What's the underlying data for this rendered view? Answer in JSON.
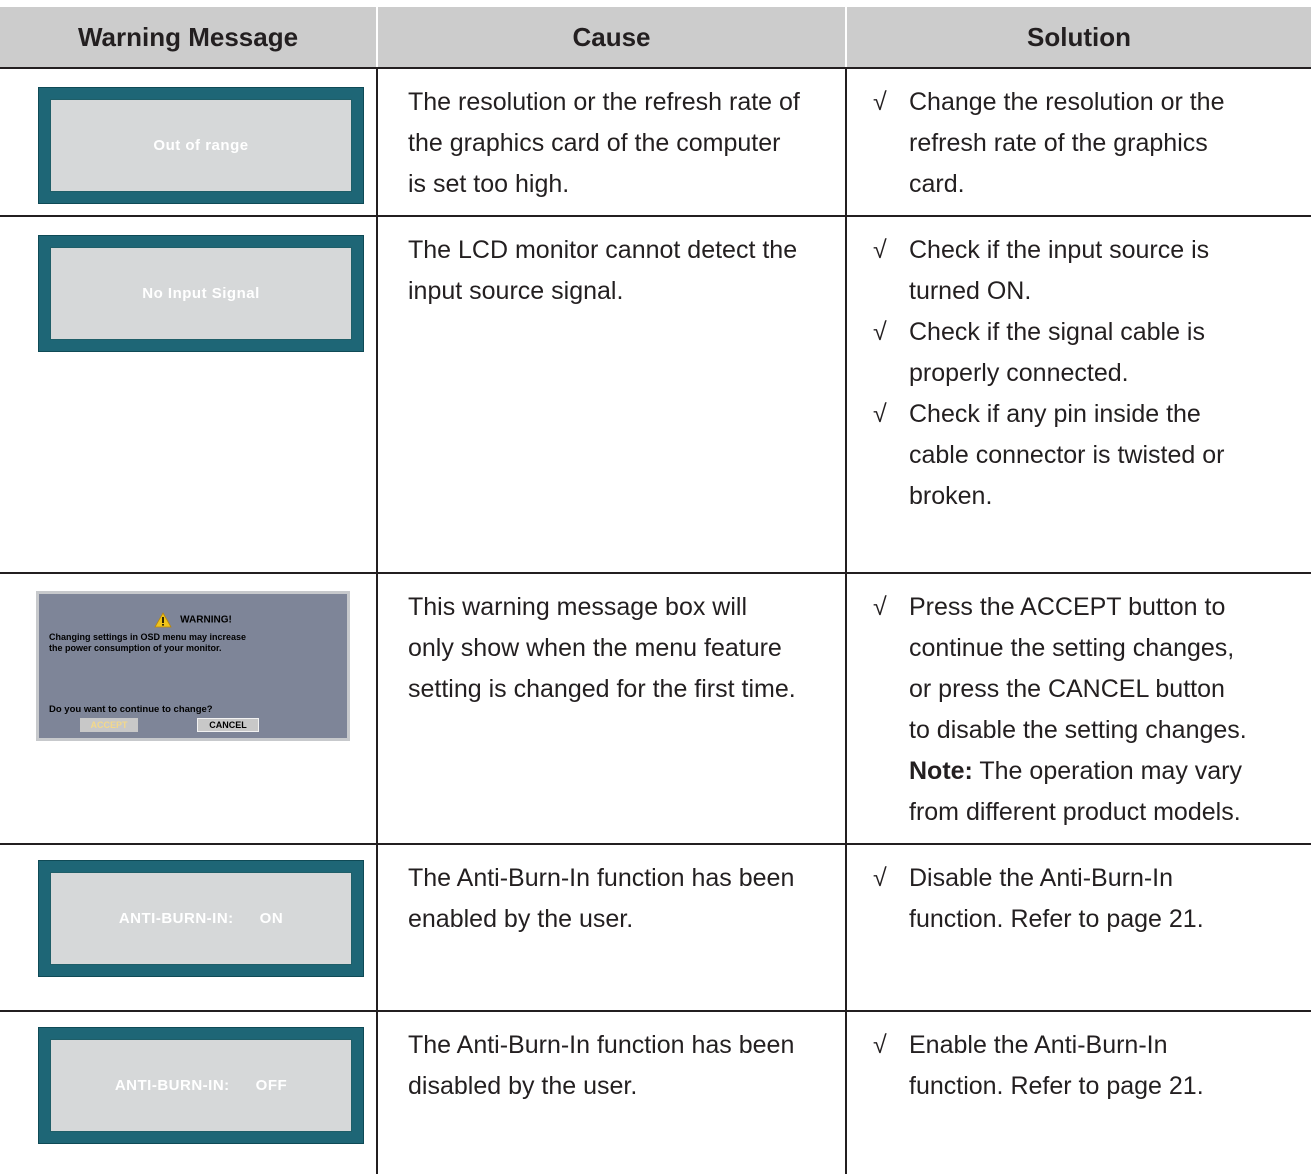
{
  "headers": {
    "warning": "Warning Message",
    "cause": "Cause",
    "solution": "Solution"
  },
  "check_symbol": "√",
  "rows": [
    {
      "osd": {
        "label": "Out of range",
        "value": ""
      },
      "cause": [
        "The resolution or the refresh rate of",
        "the graphics card of the computer",
        "is set too high."
      ],
      "solutions": [
        [
          "Change the resolution or the",
          "refresh rate of the graphics",
          "card."
        ]
      ]
    },
    {
      "osd": {
        "label": "No Input Signal",
        "value": ""
      },
      "cause": [
        "The LCD monitor cannot detect the",
        "input source signal."
      ],
      "solutions": [
        [
          "Check if the input source is",
          "turned ON."
        ],
        [
          "Check if the signal cable is",
          "properly connected."
        ],
        [
          "Check if any pin inside the",
          "cable connector is twisted or",
          "broken."
        ]
      ]
    },
    {
      "warning_box": {
        "title": "WARNING!",
        "body": [
          "Changing settings in OSD menu may increase",
          "the power consumption of your monitor."
        ],
        "question": "Do you want to continue to change?",
        "accept": "ACCEPT",
        "cancel": "CANCEL",
        "icon": "warning-triangle-icon",
        "colors": {
          "background": "#7e8598",
          "icon": "#f0c419"
        }
      },
      "cause": [
        "This warning message box will",
        "only show when the menu feature",
        "setting is changed for the first time."
      ],
      "solutions": [
        [
          "Press the ACCEPT button to",
          "continue the setting changes,",
          "or press the CANCEL button",
          "to disable the setting changes."
        ]
      ],
      "note": {
        "label": "Note:",
        "lines": [
          " The operation may vary",
          "from different product models."
        ]
      }
    },
    {
      "osd": {
        "label": "ANTI-BURN-IN:",
        "value": "ON"
      },
      "cause": [
        "The Anti-Burn-In function has been",
        "enabled by the user."
      ],
      "solutions": [
        [
          "Disable the Anti-Burn-In",
          "function. Refer to page 21."
        ]
      ]
    },
    {
      "osd": {
        "label": "ANTI-BURN-IN:",
        "value": "OFF"
      },
      "cause": [
        "The Anti-Burn-In function has been",
        "disabled by the user."
      ],
      "solutions": [
        [
          "Enable the Anti-Burn-In",
          "function. Refer to page 21."
        ]
      ]
    }
  ],
  "colors": {
    "header_bg": "#cccccc",
    "osd_frame": "#1e6676",
    "osd_fill": "#d6d8d9",
    "rule": "#231f20"
  }
}
